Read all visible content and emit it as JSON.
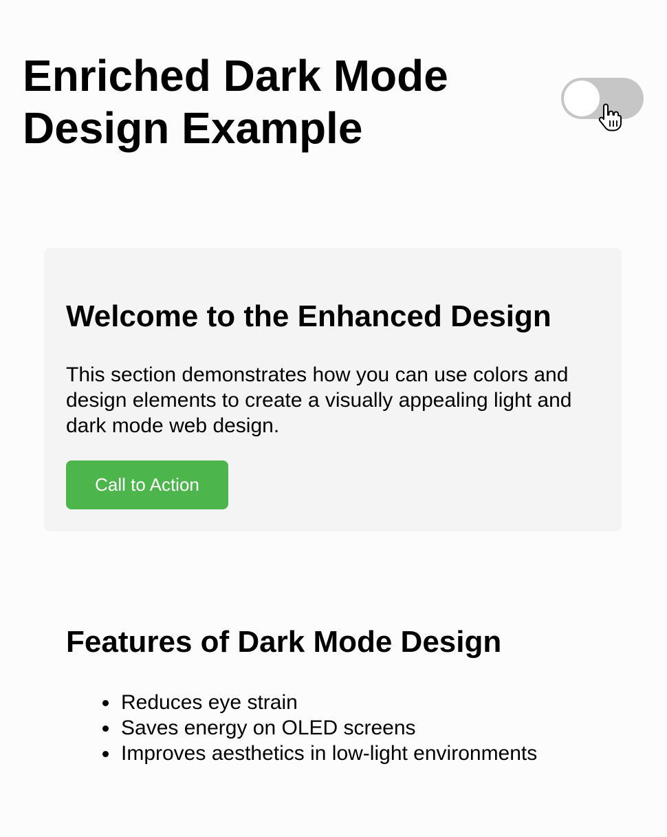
{
  "header": {
    "title": "Enriched Dark Mode Design Example",
    "theme_toggle": {
      "state": "off",
      "track_color": "#c6c6c6",
      "knob_color": "#ffffff"
    },
    "cursor_icon": "hand-pointer-icon"
  },
  "card": {
    "title": "Welcome to the Enhanced Design",
    "text": "This section demonstrates how you can use colors and design elements to create a visually appealing light and dark mode web design.",
    "button_label": "Call to Action",
    "background": "#f4f4f4",
    "button_color": "#4cb64c"
  },
  "features": {
    "title": "Features of Dark Mode Design",
    "items": [
      "Reduces eye strain",
      "Saves energy on OLED screens",
      "Improves aesthetics in low-light environments"
    ]
  },
  "colors": {
    "page_background": "#fcfcfc",
    "text": "#000000"
  }
}
